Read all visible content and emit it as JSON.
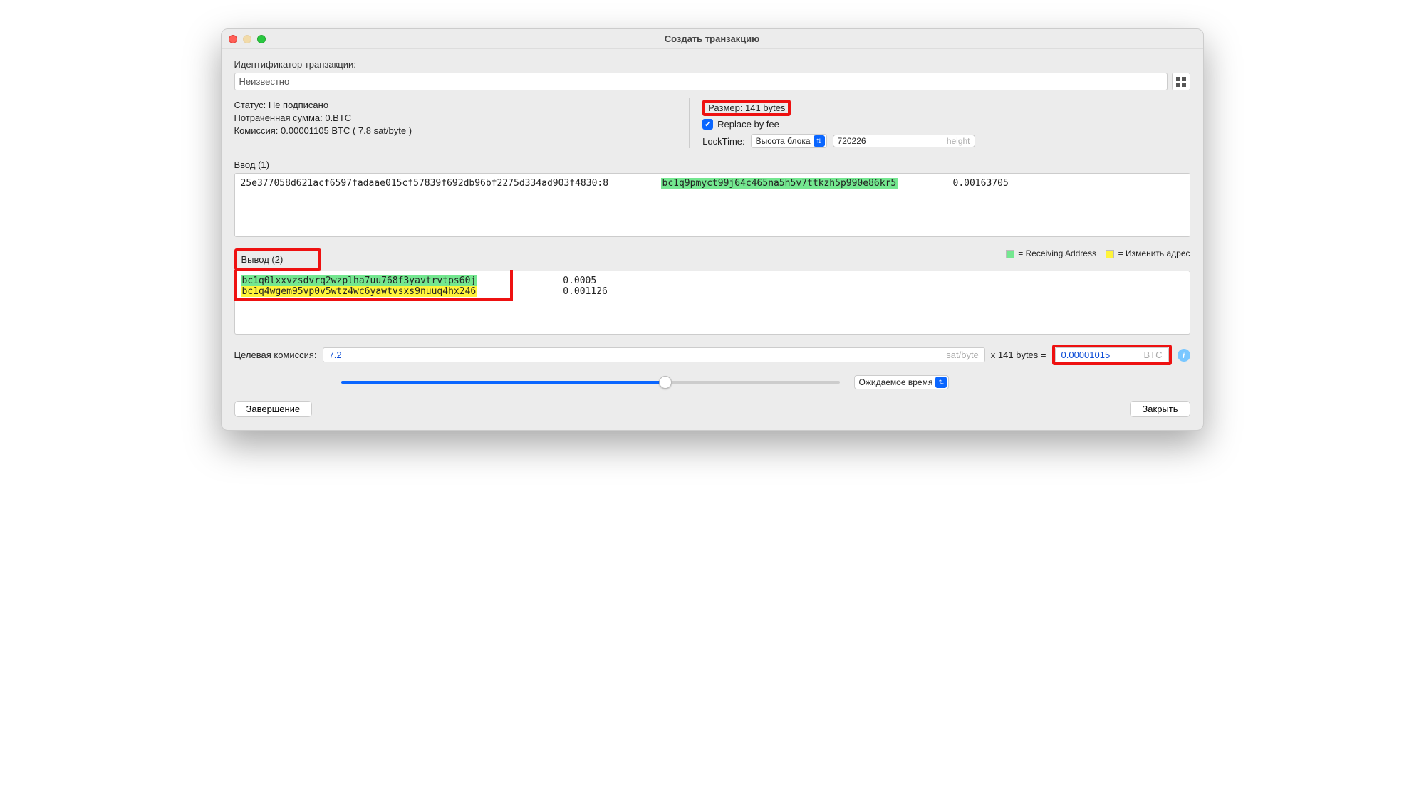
{
  "window": {
    "title": "Создать транзакцию"
  },
  "txid": {
    "label": "Идентификатор транзакции:",
    "value": "Неизвестно"
  },
  "status": {
    "status_line": "Статус: Не подписано",
    "spent_line": "Потраченная сумма: 0.BTC",
    "fee_line": "Комиссия: 0.00001105 BTC  ( 7.8 sat/byte )"
  },
  "right": {
    "size_line": "Размер: 141 bytes",
    "rbf_label": "Replace by fee",
    "locktime_label": "LockTime:",
    "locktime_select": "Высота блока",
    "locktime_value": "720226",
    "locktime_unit": "height"
  },
  "inputs": {
    "header": "Ввод (1)",
    "row": {
      "txref": "25e377058d621acf6597fadaae015cf57839f692db96bf2275d334ad903f4830:8",
      "address": "bc1q9pmyct99j64c465na5h5v7ttkzh5p990e86kr5",
      "amount": "0.00163705"
    }
  },
  "outputs": {
    "header": "Вывод (2)",
    "legend_receiving": "= Receiving Address",
    "legend_change": "= Изменить адрес",
    "rows": [
      {
        "address": "bc1q0lxxvzsdvrq2wzplha7uu768f3yavtrvtps60j",
        "amount": "0.0005",
        "cls": "addr-green"
      },
      {
        "address": "bc1q4wgem95vp0v5wtz4wc6yawtvsxs9nuuq4hx246",
        "amount": "0.001126",
        "cls": "addr-yellow"
      }
    ]
  },
  "targetfee": {
    "label": "Целевая комиссия:",
    "value": "7.2",
    "unit": "sat/byte",
    "mult_text": "x   141 bytes   =",
    "btc_value": "0.00001015",
    "btc_unit": "BTC"
  },
  "expected_time": "Ожидаемое время",
  "buttons": {
    "finish": "Завершение",
    "close": "Закрыть"
  }
}
